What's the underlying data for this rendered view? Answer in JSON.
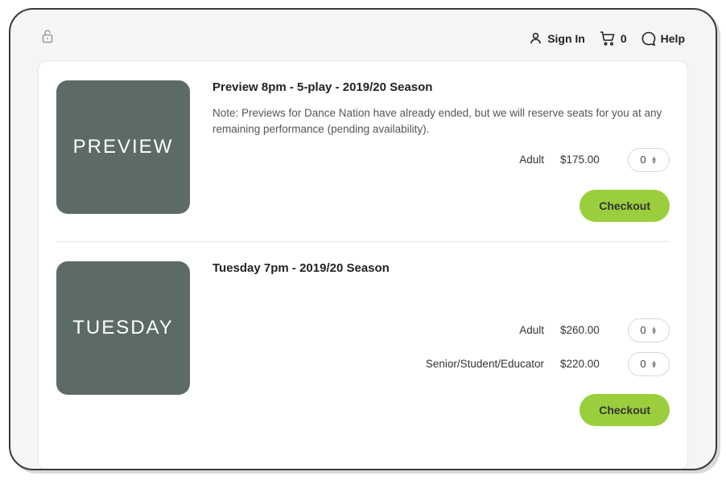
{
  "header": {
    "sign_in": "Sign In",
    "cart_count": "0",
    "help": "Help"
  },
  "items": [
    {
      "thumb_label": "PREVIEW",
      "title": "Preview 8pm - 5-play - 2019/20 Season",
      "note": "Note: Previews for Dance Nation have already ended, but we will reserve seats for you at any remaining performance (pending availability).",
      "prices": [
        {
          "label": "Adult",
          "value": "$175.00",
          "qty": "0"
        }
      ],
      "checkout": "Checkout"
    },
    {
      "thumb_label": "TUESDAY",
      "title": "Tuesday 7pm - 2019/20 Season",
      "note": "",
      "prices": [
        {
          "label": "Adult",
          "value": "$260.00",
          "qty": "0"
        },
        {
          "label": "Senior/Student/Educator",
          "value": "$220.00",
          "qty": "0"
        }
      ],
      "checkout": "Checkout"
    }
  ]
}
